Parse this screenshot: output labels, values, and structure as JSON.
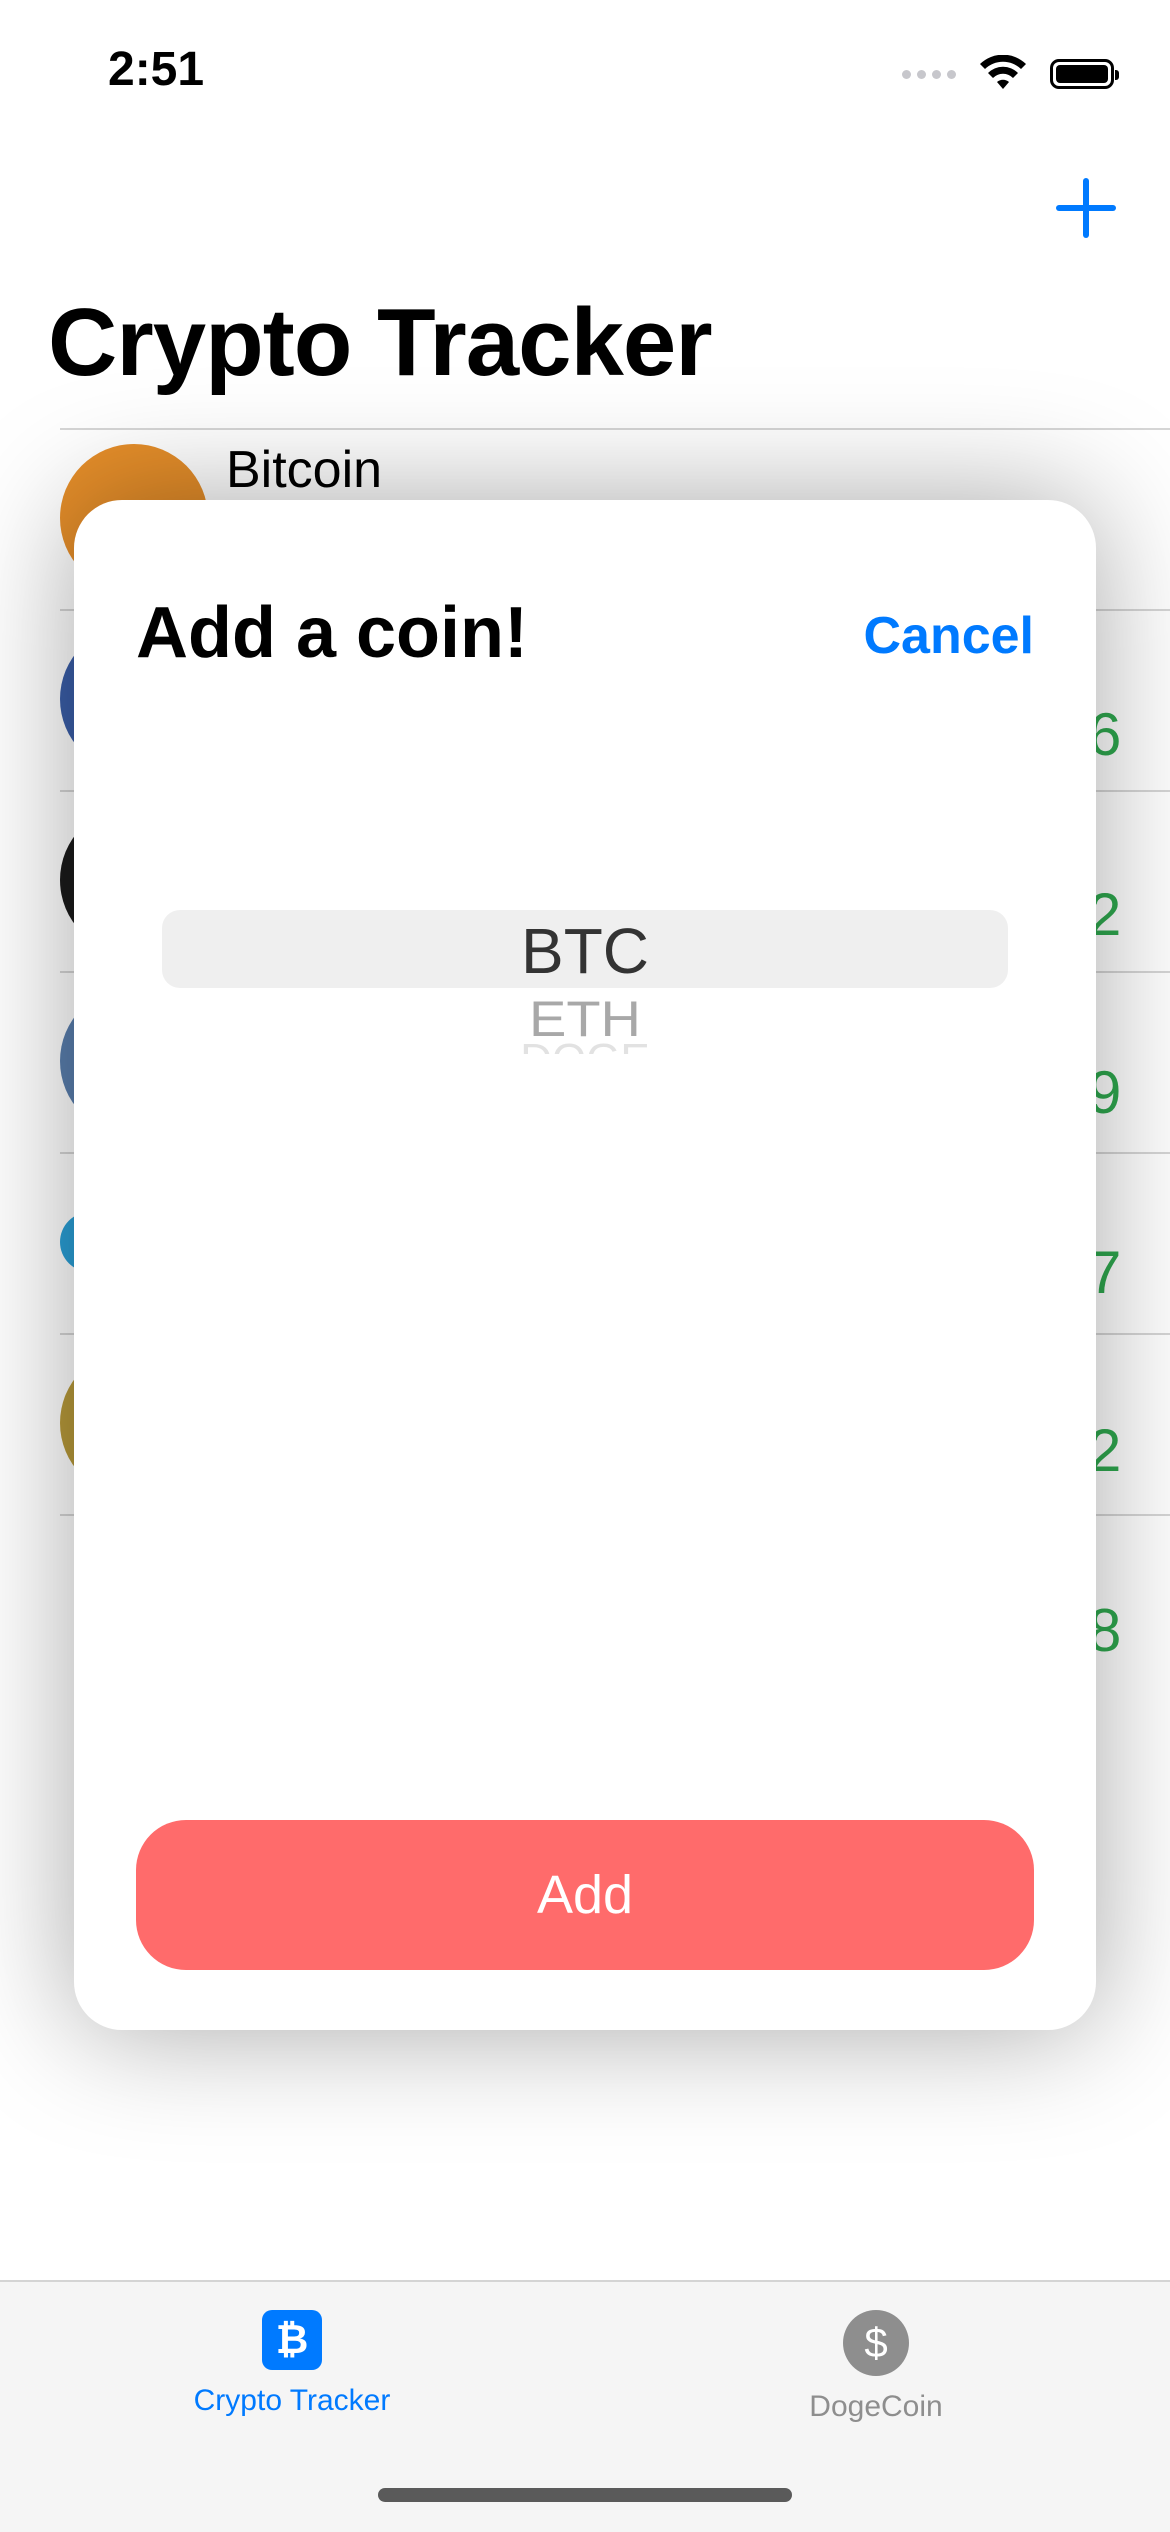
{
  "status_bar": {
    "time": "2:51",
    "icons": [
      "signal-icon",
      "wifi-icon",
      "battery-icon"
    ]
  },
  "nav": {
    "title": "Crypto Tracker",
    "add_icon": "plus-icon"
  },
  "coin_list": [
    {
      "name": "Bitcoin",
      "logo_color": "#e58e2a"
    },
    {
      "name": "",
      "logo_color": "#3a5ea8"
    },
    {
      "name": "",
      "logo_color": "#1b1b1b"
    },
    {
      "name": "",
      "logo_color": "#5a7fae"
    },
    {
      "name": "",
      "logo_color": "#2a9fd6"
    },
    {
      "name": "",
      "logo_color": "#b89a3a"
    }
  ],
  "modal": {
    "title": "Add a coin!",
    "cancel_label": "Cancel",
    "picker": {
      "selected": "BTC",
      "next": "ETH",
      "next2": "DOGE"
    },
    "add_label": "Add"
  },
  "tab_bar": {
    "tabs": [
      {
        "label": "Crypto Tracker",
        "icon": "bitcoin-icon",
        "glyph": "₿",
        "active": true
      },
      {
        "label": "DogeCoin",
        "icon": "dollar-icon",
        "glyph": "$",
        "active": false
      }
    ]
  },
  "colors": {
    "accent": "#007aff",
    "add_button": "#ff6b6b",
    "price_green": "#2fa84f"
  }
}
